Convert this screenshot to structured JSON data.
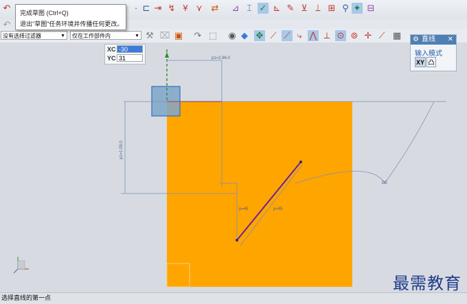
{
  "tooltip": {
    "title": "完成草图 (Ctrl+Q)",
    "desc": "退出\"草图\"任务环境并传播任何更改。"
  },
  "filters": {
    "selection_filter": "没有选择过滤器",
    "scope": "仅在工作部件内"
  },
  "coord_input": {
    "xc_label": "XC",
    "xc_value": "-30",
    "yc_label": "YC",
    "yc_value": "31"
  },
  "line_panel": {
    "title": "直线",
    "input_mode_label": "输入模式",
    "mode_xy": "XY",
    "mode_param": "凸"
  },
  "dimensions": {
    "p_top": "p1=2.96.0",
    "p_left": "p1=1.05.0",
    "p_angle": "p=45",
    "p_len": "p=95",
    "arc_label": "D5"
  },
  "status": {
    "prompt": "选择直线的第一点"
  },
  "watermark": {
    "text": "最需教育"
  },
  "colors": {
    "sketch_fill": "#FFA500",
    "line_color": "#6B1FA0",
    "accent": "#4F7FB3"
  }
}
